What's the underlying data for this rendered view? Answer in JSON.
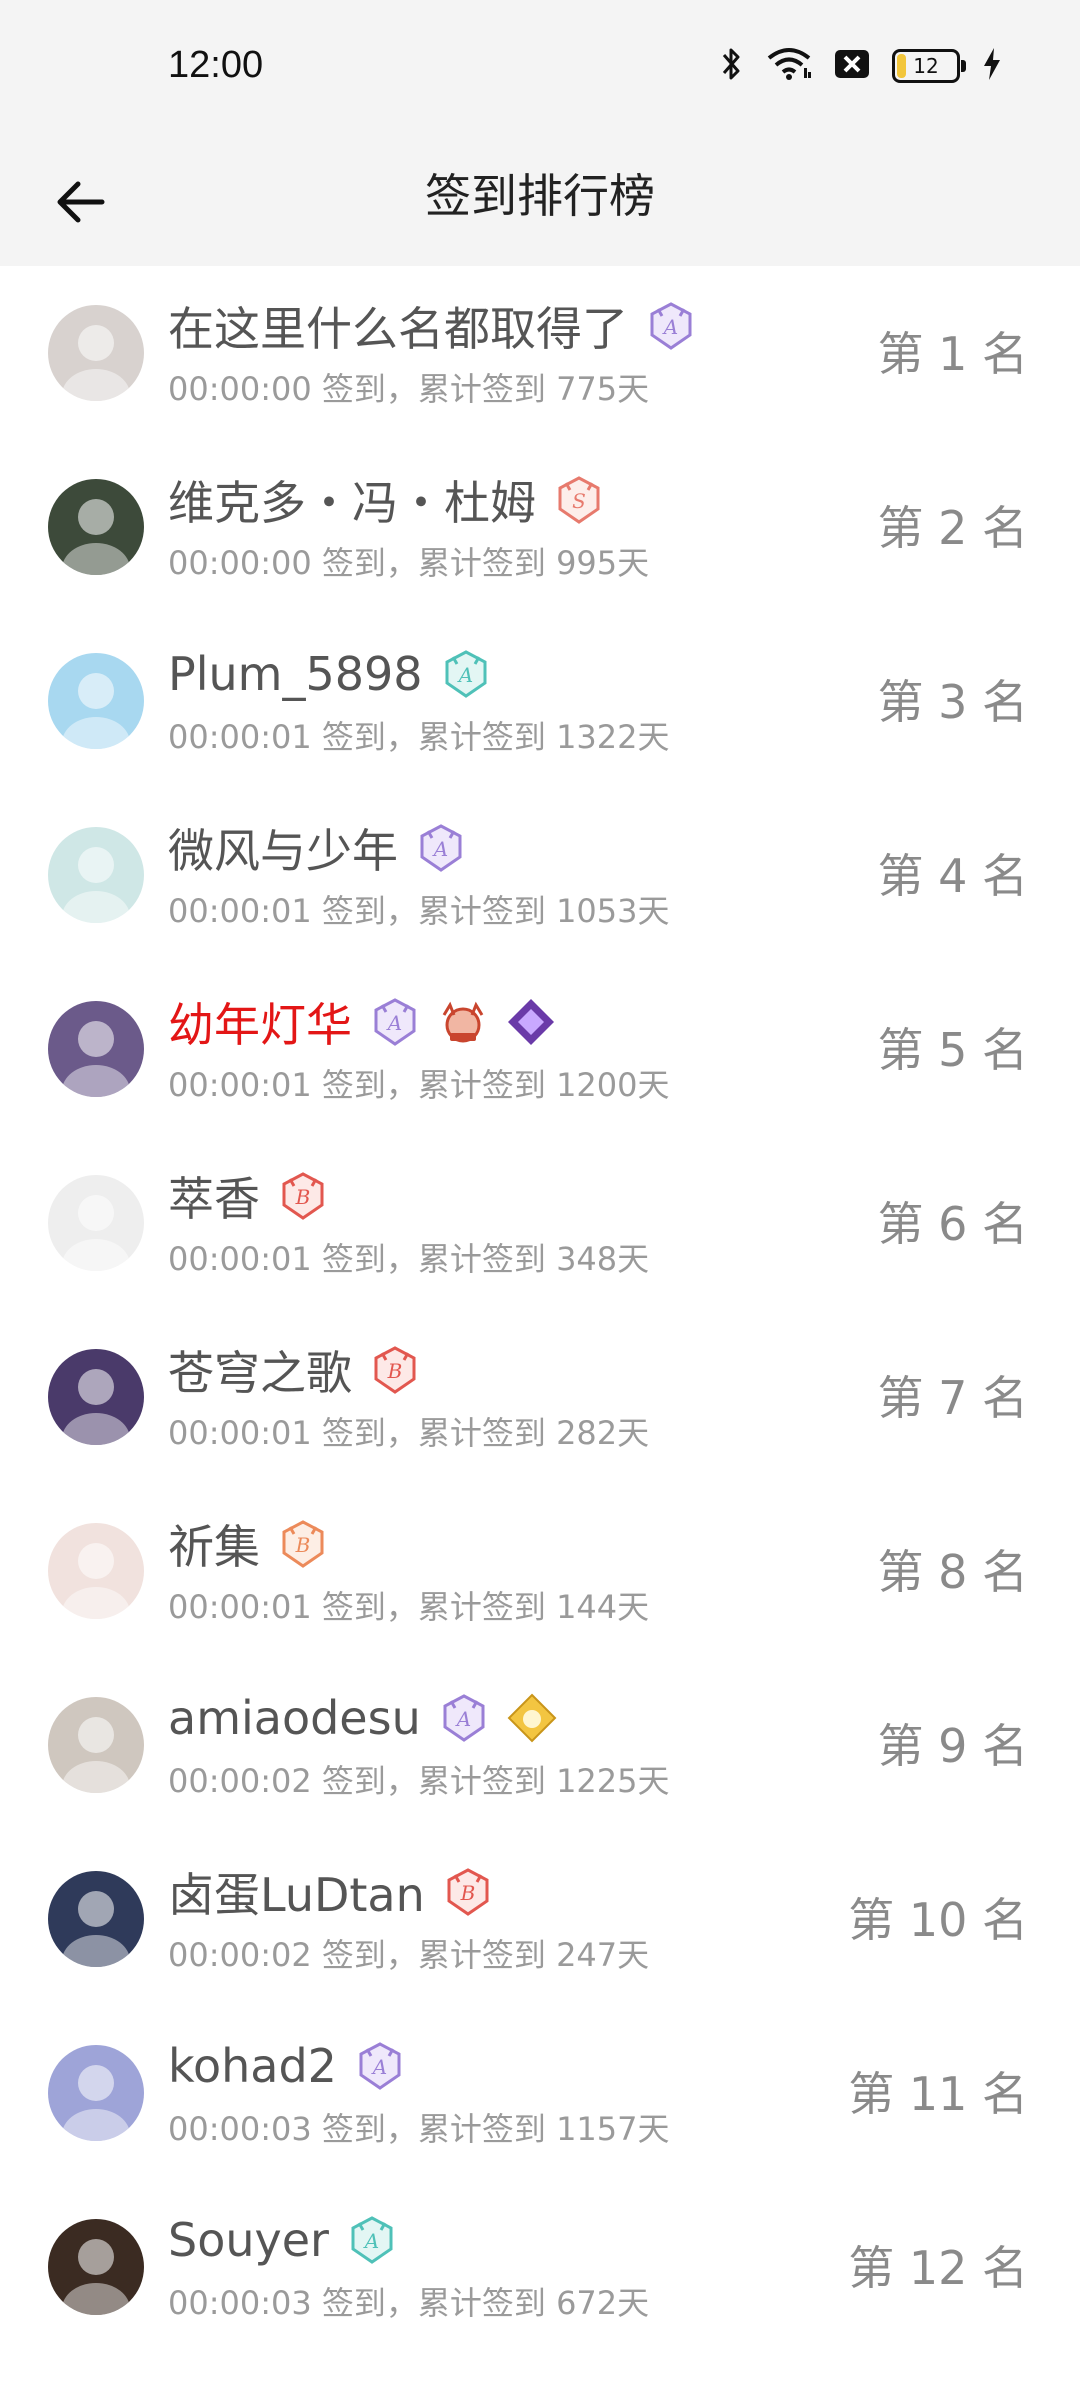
{
  "status": {
    "time": "12:00",
    "battery": "12"
  },
  "header": {
    "title": "签到排行榜"
  },
  "colors": {
    "highlight_name": "#e31616"
  },
  "rows": [
    {
      "name": "在这里什么名都取得了",
      "badges": [
        "A-purple"
      ],
      "sub": "00:00:00 签到，累计签到 775天",
      "rank": "第 1 名",
      "avatar_color": "#d8d2cf"
    },
    {
      "name": "维克多・冯・杜姆",
      "badges": [
        "S-red"
      ],
      "sub": "00:00:00 签到，累计签到 995天",
      "rank": "第 2 名",
      "avatar_color": "#3d4a3a"
    },
    {
      "name": "Plum_5898",
      "badges": [
        "A-teal"
      ],
      "sub": "00:00:01 签到，累计签到 1322天",
      "rank": "第 3 名",
      "avatar_color": "#a8d8f0"
    },
    {
      "name": "微风与少年",
      "badges": [
        "A-purple"
      ],
      "sub": "00:00:01 签到，累计签到 1053天",
      "rank": "第 4 名",
      "avatar_color": "#cfe7e6"
    },
    {
      "name": "幼年灯华",
      "badges": [
        "A-purple",
        "crab-red",
        "diamond-purple"
      ],
      "sub": "00:00:01 签到，累计签到 1200天",
      "rank": "第 5 名",
      "avatar_color": "#6b5a8a",
      "highlight": true
    },
    {
      "name": "萃香",
      "badges": [
        "B-red"
      ],
      "sub": "00:00:01 签到，累计签到 348天",
      "rank": "第 6 名",
      "avatar_color": "#eeeeee"
    },
    {
      "name": "苍穹之歌",
      "badges": [
        "B-red"
      ],
      "sub": "00:00:01 签到，累计签到 282天",
      "rank": "第 7 名",
      "avatar_color": "#4a3a6a"
    },
    {
      "name": "祈集",
      "badges": [
        "B-orange"
      ],
      "sub": "00:00:01 签到，累计签到 144天",
      "rank": "第 8 名",
      "avatar_color": "#f1e2de"
    },
    {
      "name": "amiaodesu",
      "badges": [
        "A-purple",
        "gold-diamond"
      ],
      "sub": "00:00:02 签到，累计签到 1225天",
      "rank": "第 9 名",
      "avatar_color": "#cfc7bf"
    },
    {
      "name": "卤蛋LuDtan",
      "badges": [
        "B-red"
      ],
      "sub": "00:00:02 签到，累计签到 247天",
      "rank": "第 10 名",
      "avatar_color": "#2f3a5a"
    },
    {
      "name": "kohad2",
      "badges": [
        "A-purple"
      ],
      "sub": "00:00:03 签到，累计签到 1157天",
      "rank": "第 11 名",
      "avatar_color": "#9ea4d8"
    },
    {
      "name": "Souyer",
      "badges": [
        "A-teal"
      ],
      "sub": "00:00:03 签到，累计签到 672天",
      "rank": "第 12 名",
      "avatar_color": "#3b2b22"
    }
  ]
}
